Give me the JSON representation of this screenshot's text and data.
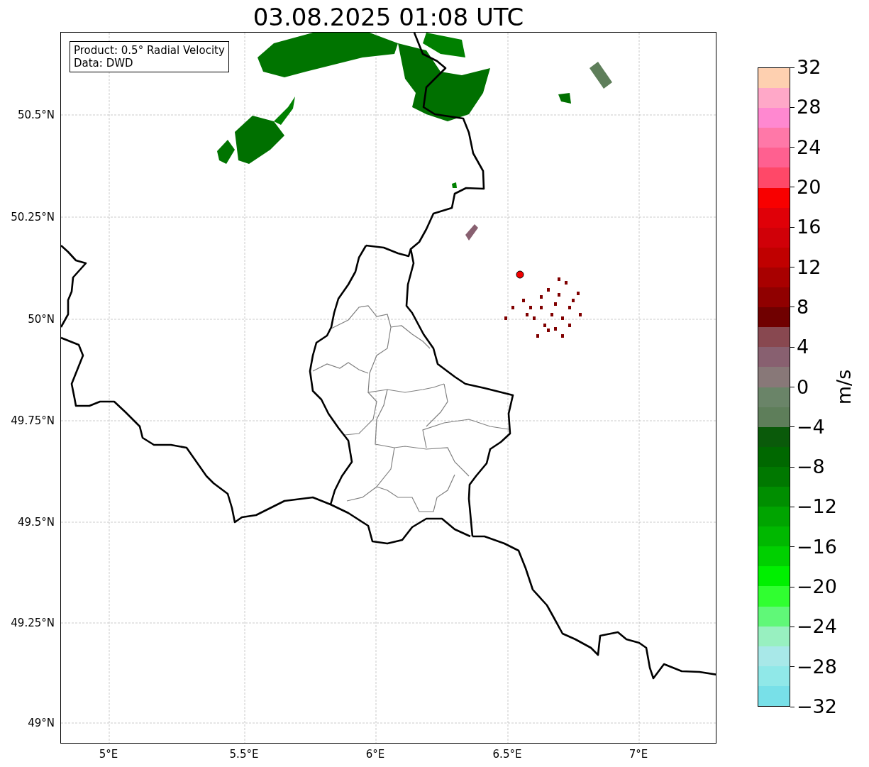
{
  "title": "03.08.2025 01:08 UTC",
  "info_box": [
    "Product: 0.5° Radial Velocity",
    "Data: DWD"
  ],
  "map": {
    "y_ticks": [
      "50.5°N",
      "50.25°N",
      "50°N",
      "49.75°N",
      "49.5°N",
      "49.25°N",
      "49°N"
    ],
    "x_ticks": [
      "5°E",
      "5.5°E",
      "6°E",
      "6.5°E",
      "7°E"
    ]
  },
  "colorbar": {
    "label": "m/s",
    "ticks": [
      "32",
      "28",
      "24",
      "20",
      "16",
      "12",
      "8",
      "4",
      "0",
      "−4",
      "−8",
      "−12",
      "−16",
      "−20",
      "−24",
      "−28",
      "−32"
    ],
    "bands": [
      {
        "color": "#fed0b0"
      },
      {
        "color": "#ffa8c8"
      },
      {
        "color": "#ff88d0"
      },
      {
        "color": "#ff78a8"
      },
      {
        "color": "#ff6090"
      },
      {
        "color": "#ff4868"
      },
      {
        "color": "#f80000"
      },
      {
        "color": "#e00008"
      },
      {
        "color": "#d00008"
      },
      {
        "color": "#c00000"
      },
      {
        "color": "#a80000"
      },
      {
        "color": "#900000"
      },
      {
        "color": "#700000"
      },
      {
        "color": "#884850"
      },
      {
        "color": "#886070"
      },
      {
        "color": "#887878"
      },
      {
        "color": "#6a8468"
      },
      {
        "color": "#5e7e5a"
      },
      {
        "color": "#0a5a0a"
      },
      {
        "color": "#006800"
      },
      {
        "color": "#007800"
      },
      {
        "color": "#008e00"
      },
      {
        "color": "#00a400"
      },
      {
        "color": "#00b800"
      },
      {
        "color": "#00d000"
      },
      {
        "color": "#00f000"
      },
      {
        "color": "#30ff30"
      },
      {
        "color": "#60f878"
      },
      {
        "color": "#98f0c0"
      },
      {
        "color": "#a8e8e8"
      },
      {
        "color": "#90e8e8"
      },
      {
        "color": "#78e0e8"
      }
    ]
  }
}
